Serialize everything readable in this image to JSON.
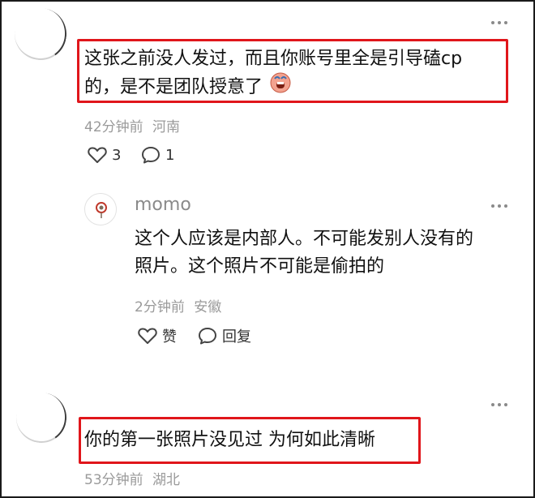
{
  "comments": [
    {
      "text_line1": "这张之前没人发过，而且你账号里全是引导磕cp",
      "text_line2": "的，是不是团队授意了",
      "emoji": "crying-face-emoji",
      "time": "42分钟前",
      "location": "河南",
      "likes": "3",
      "replies": "1"
    },
    {
      "username": "momo",
      "text_line1": "这个人应该是内部人。不可能发别人没有的",
      "text_line2": "照片。这个照片不可能是偷拍的",
      "time": "2分钟前",
      "location": "安徽",
      "like_label": "赞",
      "reply_label": "回复"
    },
    {
      "text_line1": "你的第一张照片没见过 为何如此清晰",
      "time": "53分钟前",
      "location": "湖北"
    }
  ],
  "colors": {
    "highlight": "#e0161b",
    "meta": "#9a9a9a",
    "text": "#111111"
  }
}
